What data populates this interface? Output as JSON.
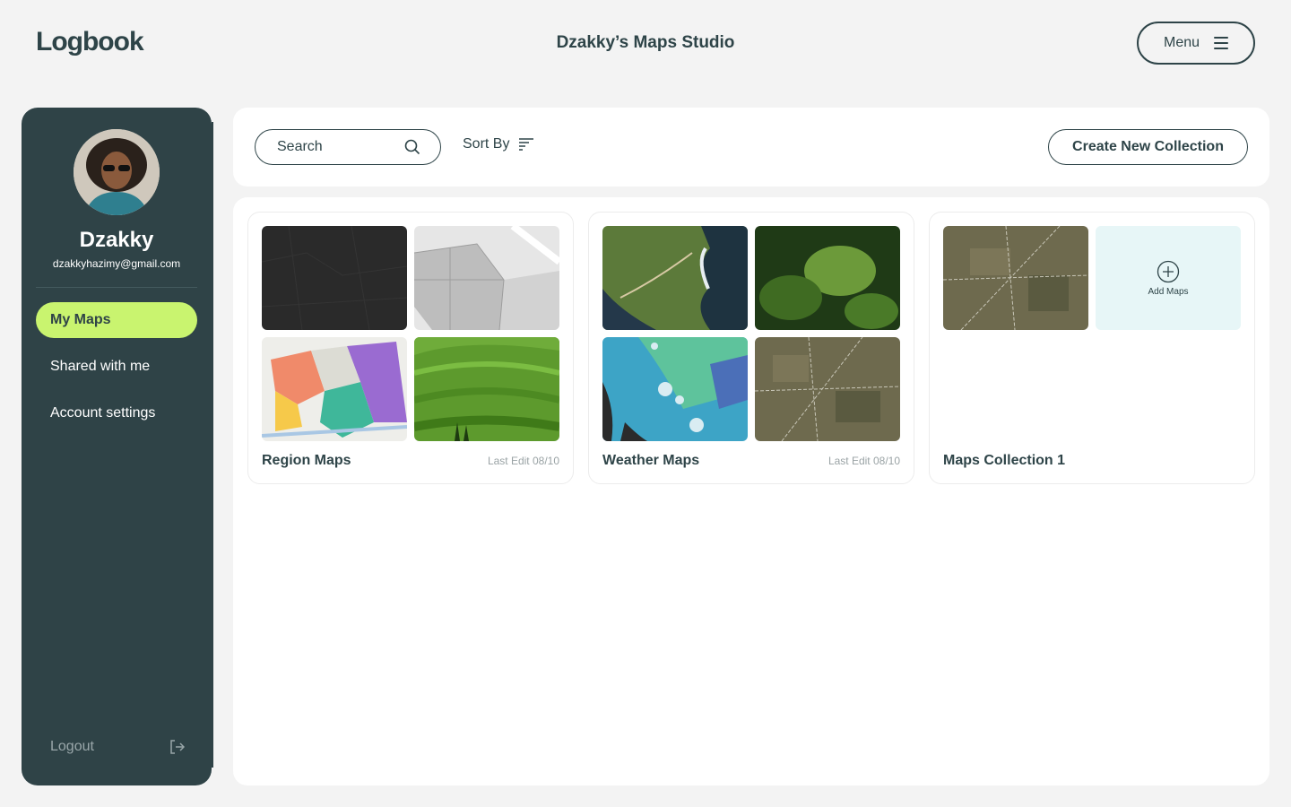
{
  "header": {
    "logo": "Logbook",
    "title": "Dzakky’s Maps Studio",
    "menu_label": "Menu"
  },
  "user": {
    "name": "Dzakky",
    "email": "dzakkyhazimy@gmail.com"
  },
  "sidebar": {
    "items": [
      {
        "label": "My Maps",
        "active": true
      },
      {
        "label": "Shared with me",
        "active": false
      },
      {
        "label": "Account settings",
        "active": false
      }
    ],
    "logout_label": "Logout"
  },
  "toolbar": {
    "search_placeholder": "Search",
    "sort_label": "Sort By",
    "create_label": "Create New Collection"
  },
  "collections": [
    {
      "title": "Region Maps",
      "date": "Last Edit 08/10"
    },
    {
      "title": "Weather Maps",
      "date": "Last Edit 08/10"
    },
    {
      "title": "Maps Collection 1",
      "date": "",
      "add_label": "Add Maps"
    }
  ],
  "colors": {
    "accent": "#c9f46f",
    "sidebar": "#2f4347",
    "text": "#2e4448"
  }
}
